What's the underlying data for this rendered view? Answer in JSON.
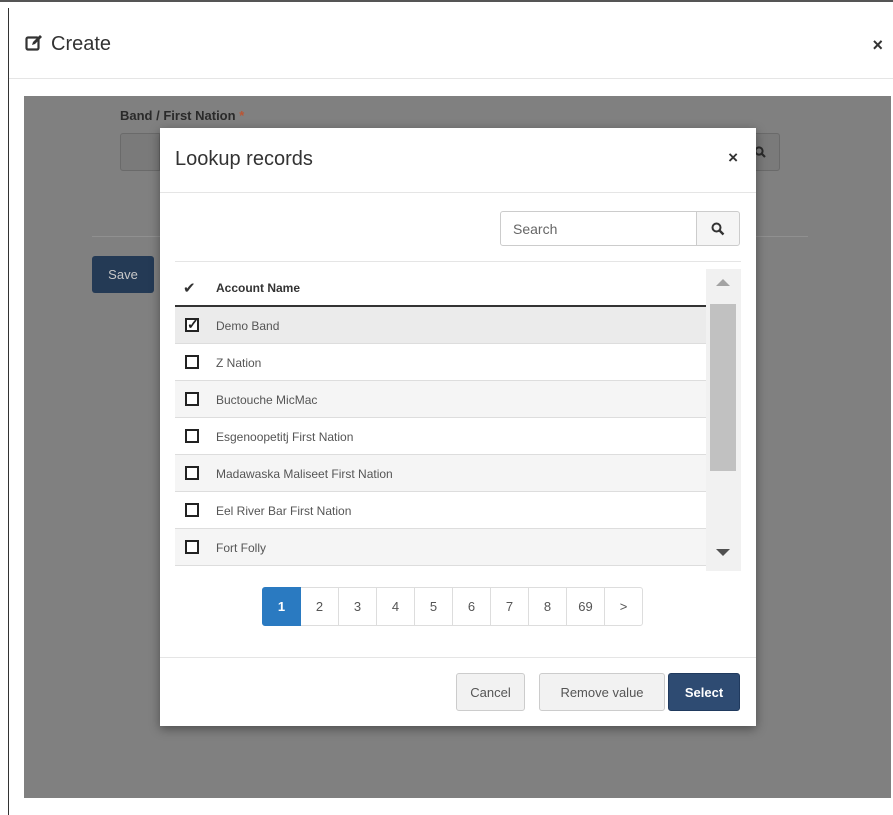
{
  "create_dialog": {
    "title": "Create",
    "title_icon": "edit-icon",
    "close_label": "×"
  },
  "form": {
    "field_label": "Band / First Nation",
    "required_marker": "*",
    "save_label": "Save"
  },
  "lookup_modal": {
    "title": "Lookup records",
    "close_label": "×",
    "search": {
      "placeholder": "Search",
      "value": "",
      "icon": "search-icon"
    },
    "grid": {
      "header_check": "✔",
      "column_header": "Account Name",
      "rows": [
        {
          "label": "Demo Band",
          "checked": true
        },
        {
          "label": "Z Nation",
          "checked": false
        },
        {
          "label": "Buctouche MicMac",
          "checked": false
        },
        {
          "label": "Esgenoopetitj First Nation",
          "checked": false
        },
        {
          "label": "Madawaska Maliseet First Nation",
          "checked": false
        },
        {
          "label": "Eel River Bar First Nation",
          "checked": false
        },
        {
          "label": "Fort Folly",
          "checked": false
        }
      ]
    },
    "pagination": {
      "pages": [
        "1",
        "2",
        "3",
        "4",
        "5",
        "6",
        "7",
        "8",
        "69",
        ">"
      ],
      "active": "1"
    },
    "footer": {
      "cancel_label": "Cancel",
      "remove_label": "Remove value",
      "select_label": "Select"
    }
  },
  "colors": {
    "primary": "#2e4b72",
    "page_active": "#2a7ac1",
    "backdrop": "#808080"
  }
}
